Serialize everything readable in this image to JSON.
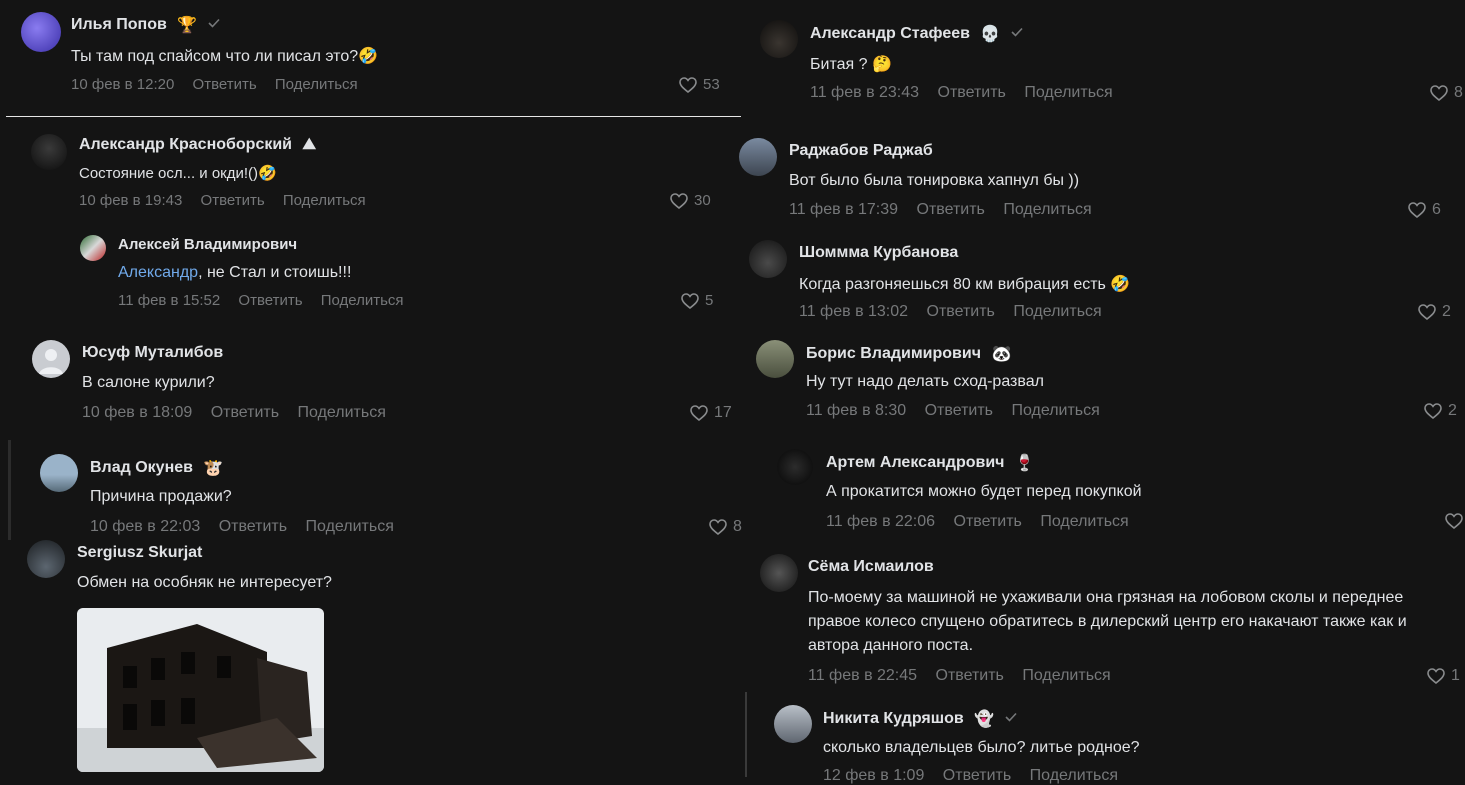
{
  "comments": [
    {
      "name": "Илья Попов",
      "badge": "🏆",
      "text": "Ты там под спайсом что ли писал это?🤣",
      "date": "10 фев в 12:20",
      "likes": "53"
    },
    {
      "name": "Александр Красноборский",
      "badge": "⛰",
      "text": "Состояние осл... и окди!()🤣",
      "date": "10 фев в 19:43",
      "likes": "30"
    },
    {
      "name": "Алексей Владимирович",
      "mention": "Александр",
      "text": ", не Стал и стоишь!!!",
      "date": "11 фев в 15:52",
      "likes": "5"
    },
    {
      "name": "Юсуф Муталибов",
      "text": "В салоне курили?",
      "date": "10 фев в 18:09",
      "likes": "17"
    },
    {
      "name": "Влад Окунев",
      "badge": "🐮",
      "text": "Причина продажи?",
      "date": "10 фев в 22:03",
      "likes": "8"
    },
    {
      "name": "Sergiusz Skurjat",
      "text": "Обмен на особняк не интересует?"
    },
    {
      "name": "Александр Стафеев",
      "badge": "💀",
      "text": "Битая ? 🤔",
      "date": "11 фев в 23:43",
      "likes": "8"
    },
    {
      "name": "Раджабов Раджаб",
      "text": "Вот было была тонировка хапнул бы ))",
      "date": "11 фев в 17:39",
      "likes": "6"
    },
    {
      "name": "Шоммма Курбанова",
      "text": "Когда разгоняешься 80 км вибрация есть 🤣",
      "date": "11 фев в 13:02",
      "likes": "2"
    },
    {
      "name": "Борис Владимирович",
      "badge": "🐼",
      "text": "Ну тут надо делать сход-развал",
      "date": "11 фев в 8:30",
      "likes": "2"
    },
    {
      "name": "Артем Александрович",
      "badge": "🍷",
      "text": "А прокатится можно будет перед покупкой",
      "date": "11 фев в 22:06"
    },
    {
      "name": "Сёма Исмаилов",
      "text": "По-моему за машиной не ухаживали она грязная на лобовом сколы и переднее правое колесо спущено обратитесь в дилерский центр его накачают также как и автора данного поста.",
      "date": "11 фев в 22:45",
      "likes": "1"
    },
    {
      "name": "Никита Кудряшов",
      "badge": "👻",
      "text": "сколько владельцев было? литье родное?",
      "date": "12 фев в 1:09"
    }
  ],
  "actions": {
    "reply": "Ответить",
    "share": "Поделиться"
  },
  "icons": {
    "like": "heart-icon",
    "verified": "check-icon"
  },
  "colors": {
    "background": "#141414",
    "text": "#e1e3e6",
    "meta": "#76787a",
    "mention": "#71aaeb"
  }
}
